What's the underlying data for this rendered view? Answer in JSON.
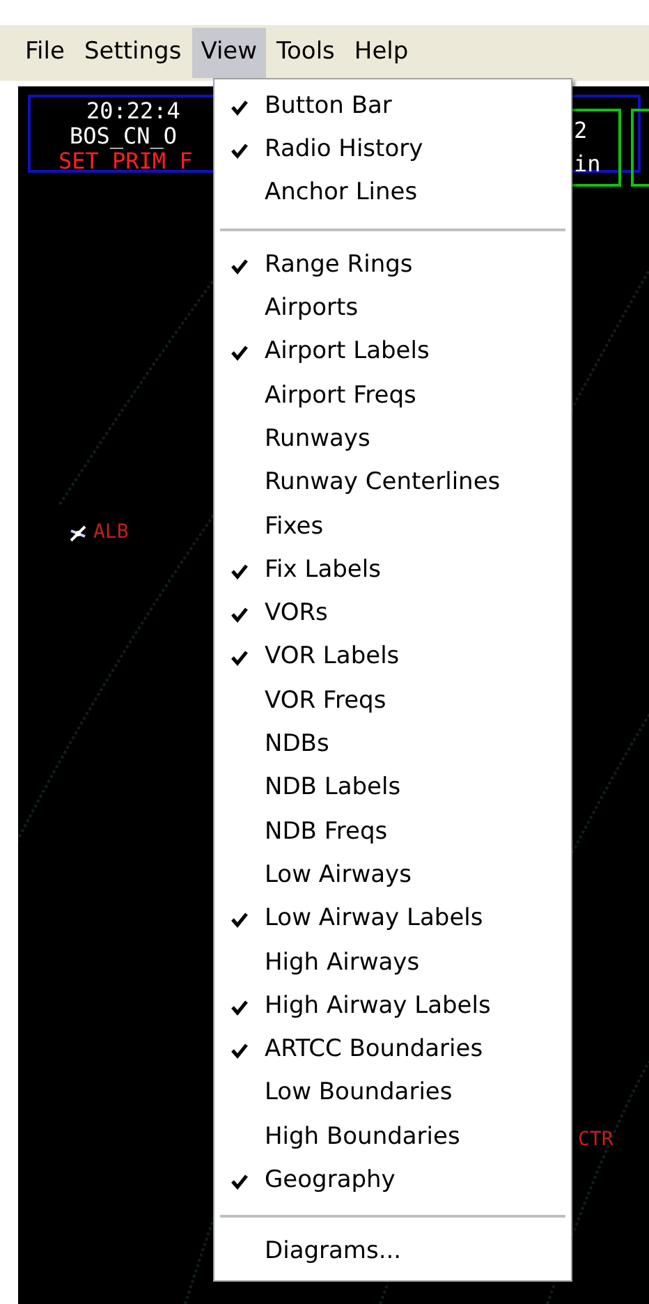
{
  "menubar": [
    {
      "label": "File",
      "selected": false
    },
    {
      "label": "Settings",
      "selected": false
    },
    {
      "label": "View",
      "selected": true
    },
    {
      "label": "Tools",
      "selected": false
    },
    {
      "label": "Help",
      "selected": false
    }
  ],
  "header": {
    "lines": [
      {
        "text": "20:22:4",
        "kind": "time"
      },
      {
        "text": "BOS_CN_O",
        "kind": "callsign"
      },
      {
        "text": "SET PRIM F",
        "kind": "alert"
      }
    ],
    "box_lines": [
      "2",
      "in"
    ]
  },
  "map_labels": [
    {
      "text": "ALB",
      "kind": "airport"
    },
    {
      "text": "CTR",
      "kind": "label"
    }
  ],
  "view_menu": [
    {
      "kind": "item",
      "label": "Button Bar",
      "checked": true
    },
    {
      "kind": "item",
      "label": "Radio History",
      "checked": true
    },
    {
      "kind": "item",
      "label": "Anchor Lines",
      "checked": false
    },
    {
      "kind": "separator"
    },
    {
      "kind": "item",
      "label": "Range Rings",
      "checked": true
    },
    {
      "kind": "item",
      "label": "Airports",
      "checked": false
    },
    {
      "kind": "item",
      "label": "Airport Labels",
      "checked": true
    },
    {
      "kind": "item",
      "label": "Airport Freqs",
      "checked": false
    },
    {
      "kind": "item",
      "label": "Runways",
      "checked": false
    },
    {
      "kind": "item",
      "label": "Runway Centerlines",
      "checked": false
    },
    {
      "kind": "item",
      "label": "Fixes",
      "checked": false
    },
    {
      "kind": "item",
      "label": "Fix Labels",
      "checked": true
    },
    {
      "kind": "item",
      "label": "VORs",
      "checked": true
    },
    {
      "kind": "item",
      "label": "VOR Labels",
      "checked": true
    },
    {
      "kind": "item",
      "label": "VOR Freqs",
      "checked": false
    },
    {
      "kind": "item",
      "label": "NDBs",
      "checked": false
    },
    {
      "kind": "item",
      "label": "NDB Labels",
      "checked": false
    },
    {
      "kind": "item",
      "label": "NDB Freqs",
      "checked": false
    },
    {
      "kind": "item",
      "label": "Low Airways",
      "checked": false
    },
    {
      "kind": "item",
      "label": "Low Airway Labels",
      "checked": true
    },
    {
      "kind": "item",
      "label": "High Airways",
      "checked": false
    },
    {
      "kind": "item",
      "label": "High Airway Labels",
      "checked": true
    },
    {
      "kind": "item",
      "label": "ARTCC Boundaries",
      "checked": true
    },
    {
      "kind": "item",
      "label": "Low Boundaries",
      "checked": false
    },
    {
      "kind": "item",
      "label": "High Boundaries",
      "checked": false
    },
    {
      "kind": "item",
      "label": "Geography",
      "checked": true
    },
    {
      "kind": "separator"
    },
    {
      "kind": "item",
      "label": "Diagrams...",
      "checked": false
    }
  ]
}
